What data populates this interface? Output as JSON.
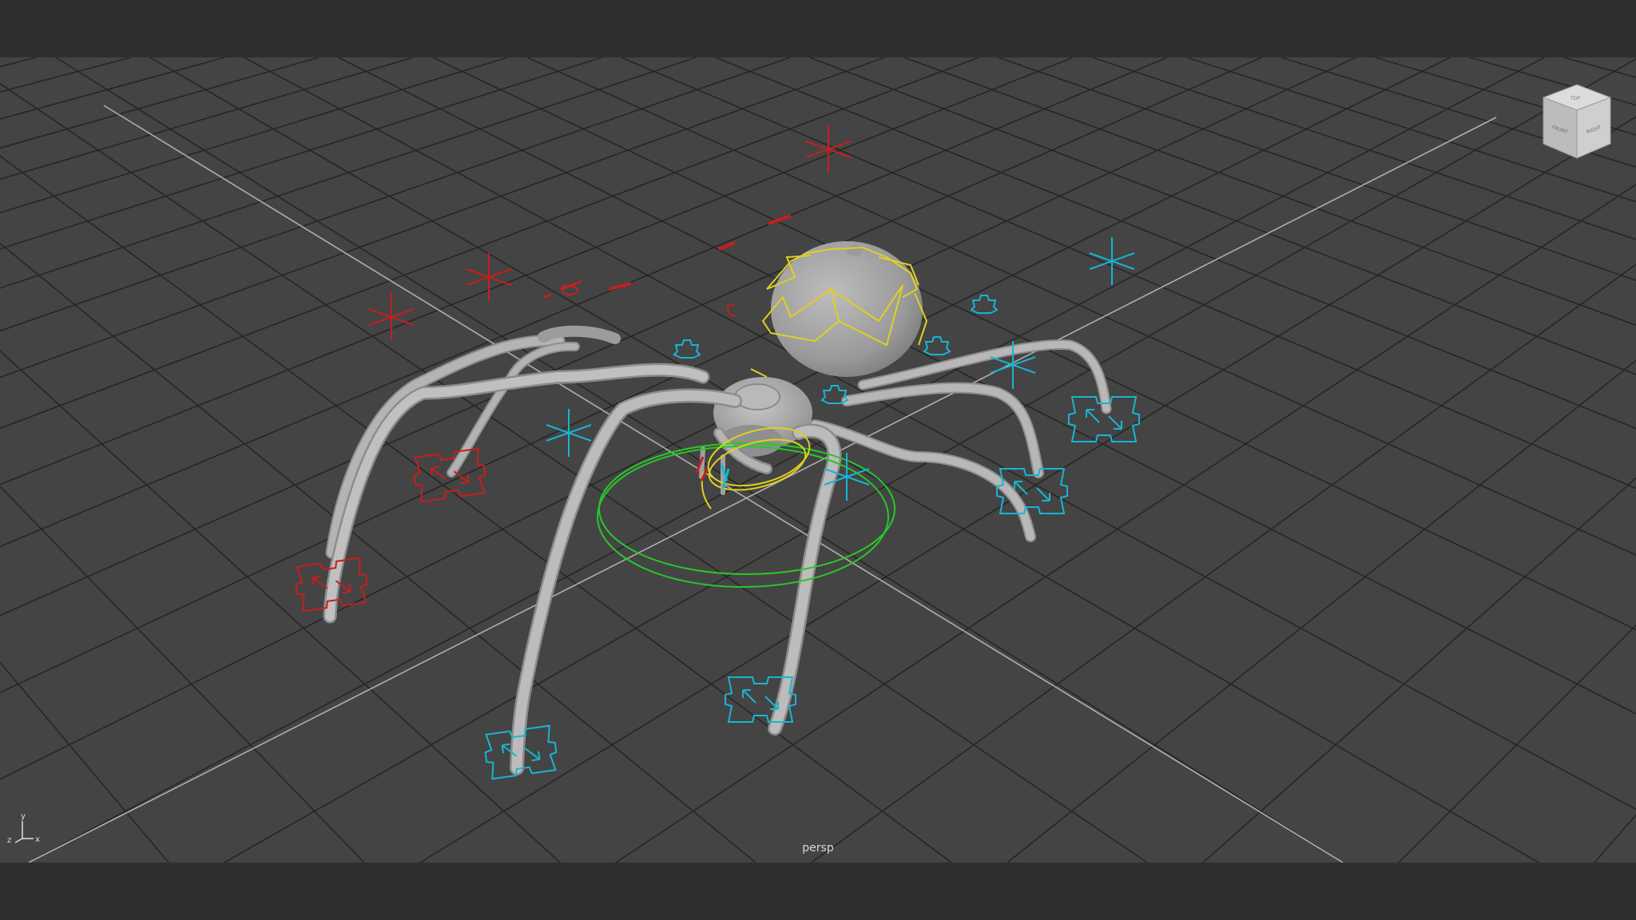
{
  "viewport": {
    "camera_label": "persp",
    "axis_labels": {
      "x": "x",
      "y": "y",
      "z": "z"
    },
    "viewcube_faces": {
      "top": "TOP",
      "front": "FRONT",
      "right": "RIGHT"
    }
  },
  "colors": {
    "background": "#444444",
    "grid_line": "#262626",
    "grid_axis": "#b8b8b8",
    "mesh": "#a8a8a8",
    "control_selected": "#e0d020",
    "control_left": "#c81e1e",
    "control_right": "#18b4d2",
    "control_root": "#28c828"
  }
}
